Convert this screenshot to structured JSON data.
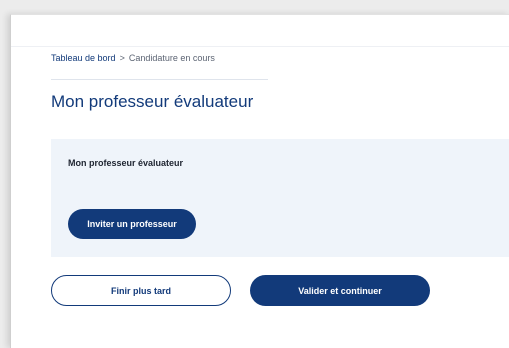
{
  "breadcrumb": {
    "home": "Tableau de bord",
    "separator": ">",
    "current": "Candidature en cours"
  },
  "page": {
    "title": "Mon professeur évaluateur"
  },
  "panel": {
    "title": "Mon professeur évaluateur",
    "invite_button": "Inviter un professeur"
  },
  "actions": {
    "later_button": "Finir plus tard",
    "validate_button": "Valider et continuer"
  },
  "colors": {
    "primary": "#123a7a",
    "panel_background": "#eff4fa"
  }
}
